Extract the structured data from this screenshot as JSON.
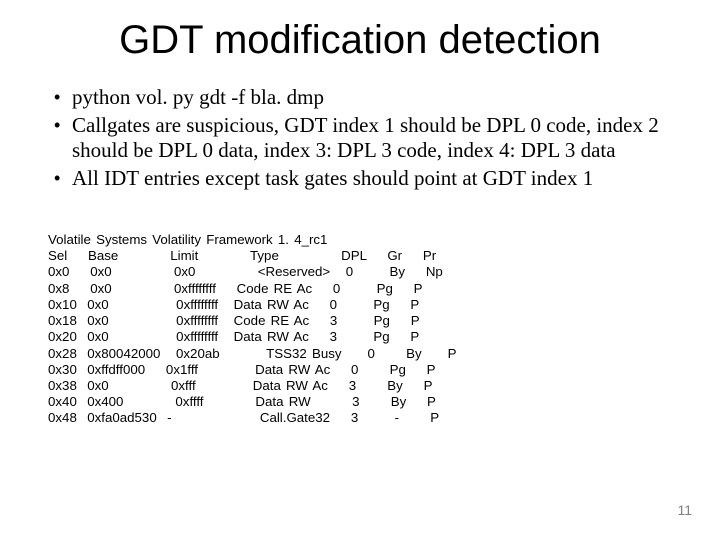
{
  "title": "GDT modification detection",
  "bullets": [
    "python vol. py gdt -f bla. dmp",
    "Callgates are suspicious, GDT index 1 should be DPL 0 code, index 2 should be DPL 0 data, index 3: DPL 3 code, index 4: DPL 3 data",
    "All IDT entries except task gates should point at GDT index 1"
  ],
  "code_lines": [
    "Volatile Systems Volatility Framework 1. 4_rc1",
    "Sel    Base          Limit          Type            DPL    Gr    Pr",
    "0x0    0x0            0x0            <Reserved>   0       By    Np",
    "0x8    0x0            0xffffffff    Code RE Ac    0       Pg    P",
    "0x10  0x0             0xffffffff   Data RW Ac    0       Pg    P",
    "0x18  0x0             0xffffffff   Code RE Ac    3       Pg    P",
    "0x20  0x0             0xffffffff   Data RW Ac    3       Pg    P",
    "0x28  0x80042000   0x20ab         TSS32 Busy     0      By     P",
    "0x30  0xffdff000    0x1fff           Data RW Ac    0      Pg    P",
    "0x38  0x0            0xfff           Data RW Ac    3      By    P",
    "0x40  0x400          0xffff          Data RW        3      By    P",
    "0x48  0xfa0ad530  -                 Call.Gate32    3       -      P"
  ],
  "page_number": "11"
}
